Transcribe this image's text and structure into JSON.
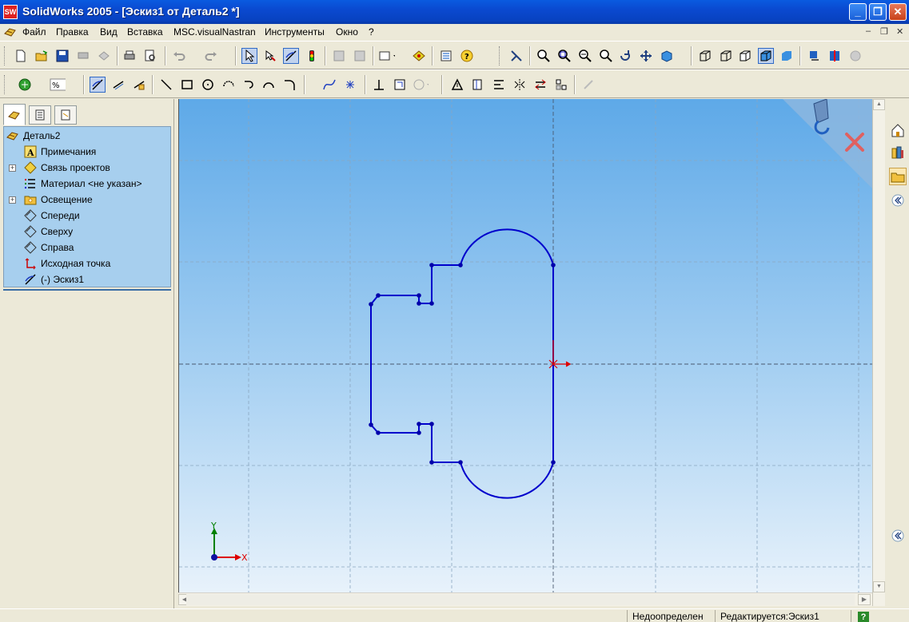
{
  "window": {
    "title": "SolidWorks 2005 - [Эскиз1 от Деталь2 *]",
    "app_icon_text": "SW",
    "minimize_label": "_",
    "maximize_label": "❐",
    "close_label": "✕"
  },
  "menu": {
    "items": [
      "Файл",
      "Правка",
      "Вид",
      "Вставка",
      "MSC.visualNastran",
      "Инструменты",
      "Окно",
      "?"
    ],
    "doc_controls": [
      "–",
      "❐",
      "✕"
    ]
  },
  "feature_tree": {
    "root": "Деталь2",
    "items": [
      {
        "label": "Примечания",
        "icon": "annotations-icon",
        "expandable": false
      },
      {
        "label": "Связь проектов",
        "icon": "design-binder-icon",
        "expandable": true
      },
      {
        "label": "Материал <не указан>",
        "icon": "material-icon",
        "expandable": false
      },
      {
        "label": "Освещение",
        "icon": "lighting-icon",
        "expandable": true
      },
      {
        "label": "Спереди",
        "icon": "plane-icon",
        "expandable": false
      },
      {
        "label": "Сверху",
        "icon": "plane-icon",
        "expandable": false
      },
      {
        "label": "Справа",
        "icon": "plane-icon",
        "expandable": false
      },
      {
        "label": "Исходная точка",
        "icon": "origin-icon",
        "expandable": false
      },
      {
        "label": "(-) Эскиз1",
        "icon": "sketch-icon",
        "expandable": false
      }
    ]
  },
  "canvas": {
    "axis_x_label": "X",
    "axis_y_label": "Y"
  },
  "status": {
    "definition": "Недоопределен",
    "editing": "Редактируется:Эскиз1",
    "help": "?"
  },
  "colors": {
    "sketch": "#0000cc",
    "background_top": "#5ea9e8",
    "background_bottom": "#e8f2fb",
    "title_bar": "#0a5be0"
  }
}
